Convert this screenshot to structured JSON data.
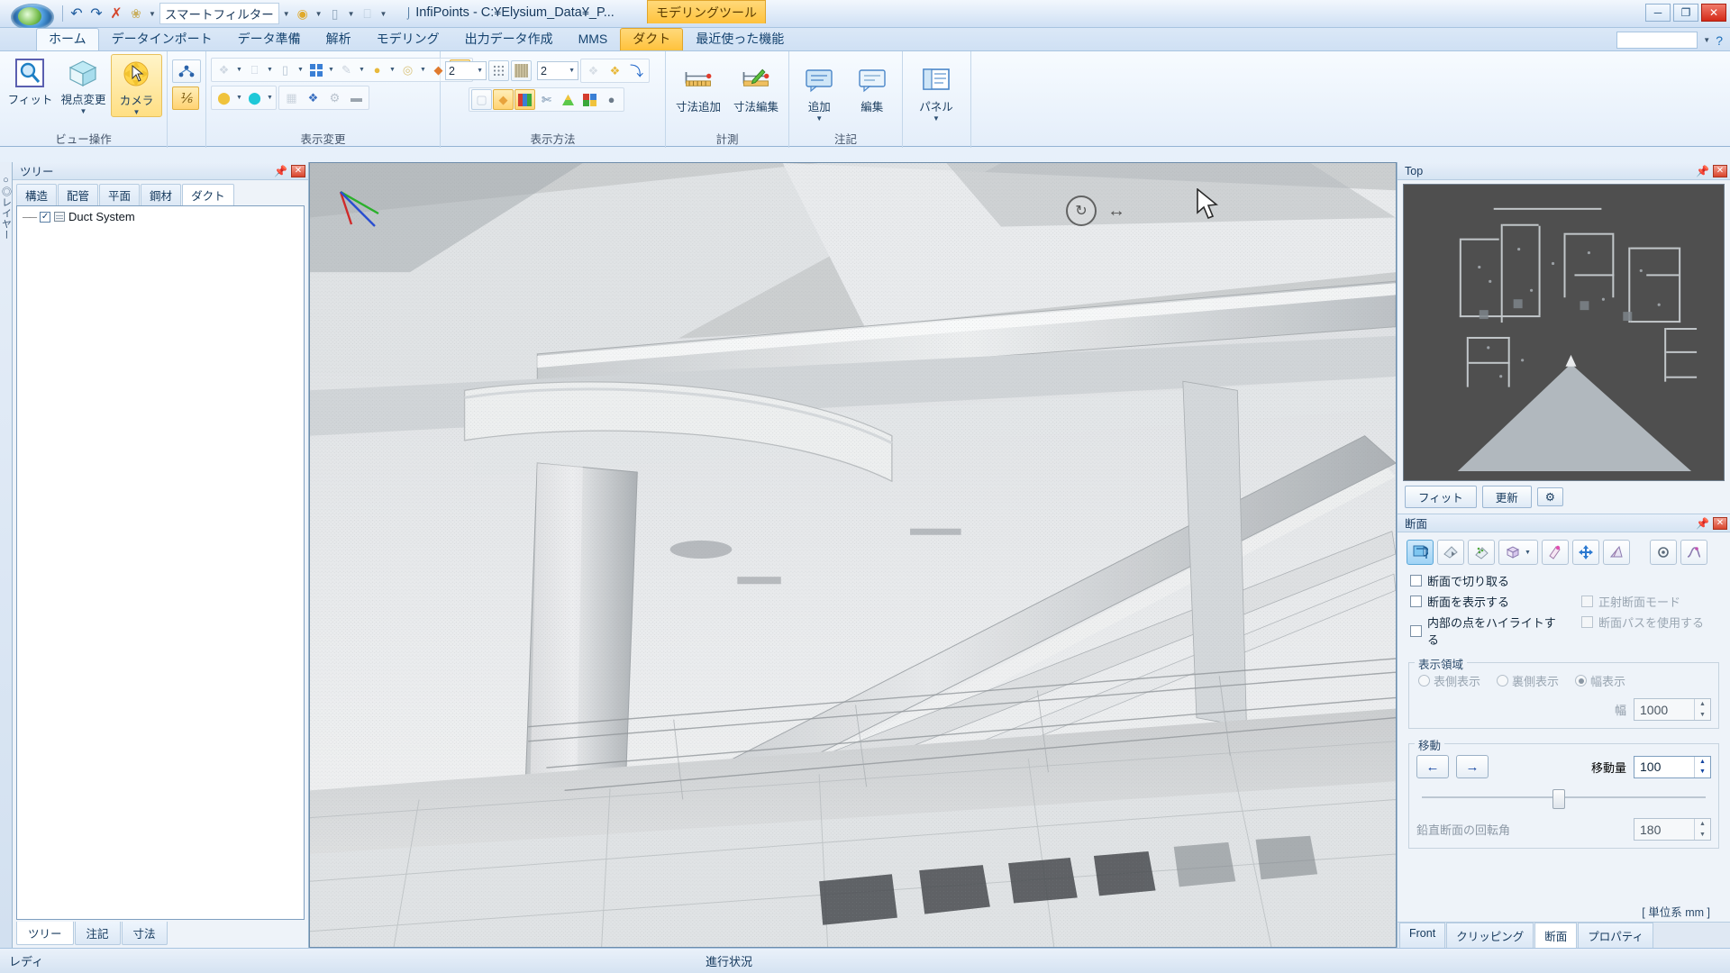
{
  "titlebar": {
    "app_title": "InfiPoints - C:¥Elysium_Data¥_P...",
    "context_tab": "モデリングツール",
    "quick_access": [
      {
        "name": "undo-icon",
        "glyph": "↩"
      },
      {
        "name": "redo-icon",
        "glyph": "↪"
      },
      {
        "name": "delete-icon",
        "glyph": "✕"
      },
      {
        "name": "filter-icon",
        "glyph": "⚘"
      }
    ],
    "smart_filter_label": "スマートフィルター",
    "window_controls": {
      "minimize": "─",
      "maximize": "❐",
      "close": "✕"
    }
  },
  "ribbon": {
    "tabs": [
      {
        "label": "ホーム",
        "state": "active"
      },
      {
        "label": "データインポート",
        "state": ""
      },
      {
        "label": "データ準備",
        "state": ""
      },
      {
        "label": "解析",
        "state": ""
      },
      {
        "label": "モデリング",
        "state": ""
      },
      {
        "label": "出力データ作成",
        "state": ""
      },
      {
        "label": "MMS",
        "state": ""
      },
      {
        "label": "ダクト",
        "state": "ctxactive"
      },
      {
        "label": "最近使った機能",
        "state": ""
      }
    ],
    "help_icon": "?",
    "groups": [
      {
        "name": "view-ops",
        "title": "ビュー操作",
        "big_buttons": [
          {
            "label": "フィット",
            "icon": "magnifier-icon",
            "dropdown": false,
            "selected": false
          },
          {
            "label": "視点変更",
            "icon": "cube-icon",
            "dropdown": true,
            "selected": false
          },
          {
            "label": "カメラ",
            "icon": "camera-orbit-icon",
            "dropdown": true,
            "selected": true
          }
        ]
      },
      {
        "name": "display-change",
        "title": "表示変更",
        "small_rows": [
          [
            {
              "icon": "point-cloud-icon",
              "dropdown": true,
              "framed": true
            },
            {
              "icon": "sparse-points-icon",
              "dropdown": true
            },
            {
              "icon": "mesh-outline-icon",
              "dropdown": true
            },
            {
              "icon": "cylinder-icon",
              "dropdown": true
            },
            {
              "icon": "grid-blue-icon",
              "dropdown": true,
              "on": false
            },
            {
              "icon": "pen-icon",
              "dropdown": true
            },
            {
              "icon": "sphere-yellow-icon",
              "dropdown": true
            },
            {
              "icon": "rings-icon",
              "dropdown": true
            },
            {
              "icon": "plane-orange-icon",
              "dropdown": false
            },
            {
              "icon": "cylinder-white-icon",
              "dropdown": false,
              "on": true
            }
          ],
          [
            {
              "icon": "yellow-chip-icon",
              "dropdown": true
            },
            {
              "icon": "cyan-sphere-icon",
              "dropdown": true
            },
            {
              "icon": "mesh-gray-icon",
              "dropdown": false
            },
            {
              "icon": "person-marker-icon",
              "dropdown": false
            },
            {
              "icon": "gear-icon",
              "dropdown": false
            },
            {
              "icon": "texture-icon",
              "dropdown": false
            }
          ]
        ]
      },
      {
        "name": "display-method",
        "title": "表示方法",
        "combo1": "2",
        "combo2": "2",
        "small_rows": [
          [
            {
              "icon": "dot-grid-icon"
            },
            {
              "icon": "stripe-icon"
            },
            {
              "icon": "points-faint-icon"
            },
            {
              "icon": "points-yellow-icon"
            },
            {
              "icon": "pick-point-icon"
            }
          ],
          [
            {
              "icon": "box-white-icon"
            },
            {
              "icon": "box-orange-icon",
              "on": true
            },
            {
              "icon": "color-bars-icon",
              "on": true
            },
            {
              "icon": "scissors-icon"
            },
            {
              "icon": "gradient-triangle-icon"
            },
            {
              "icon": "color-grid-icon"
            },
            {
              "icon": "shadow-ball-icon"
            }
          ]
        ]
      },
      {
        "name": "measurement",
        "title": "計測",
        "big_buttons": [
          {
            "label": "寸法追加",
            "icon": "dimension-add-icon",
            "dropdown": false,
            "selected": false
          },
          {
            "label": "寸法編集",
            "icon": "dimension-edit-icon",
            "dropdown": false,
            "selected": false
          }
        ]
      },
      {
        "name": "annotation",
        "title": "注記",
        "big_buttons": [
          {
            "label": "追加",
            "icon": "note-add-icon",
            "dropdown": true,
            "selected": false
          },
          {
            "label": "編集",
            "icon": "note-edit-icon",
            "dropdown": false,
            "selected": false
          }
        ]
      },
      {
        "name": "panel-group",
        "title": "",
        "big_buttons": [
          {
            "label": "パネル",
            "icon": "panel-icon",
            "dropdown": true,
            "selected": false
          }
        ]
      }
    ]
  },
  "left_panel": {
    "title": "ツリー",
    "tabs": [
      {
        "label": "構造",
        "active": false
      },
      {
        "label": "配管",
        "active": false
      },
      {
        "label": "平面",
        "active": false
      },
      {
        "label": "鋼材",
        "active": false
      },
      {
        "label": "ダクト",
        "active": true
      }
    ],
    "tree_items": [
      {
        "label": "Duct System",
        "checked": true
      }
    ],
    "bottom_tabs": [
      {
        "label": "ツリー",
        "active": true
      },
      {
        "label": "注記",
        "active": false
      },
      {
        "label": "寸法",
        "active": false
      }
    ]
  },
  "side_strip_label": "○◎レイヤー",
  "viewport": {
    "name": "point-cloud-3d-view",
    "nav_icons": [
      "orbit-icon",
      "pan-icon"
    ],
    "cursor": "mouse-pointer-icon"
  },
  "right_dock": {
    "top_panel": {
      "title": "Top",
      "buttons": [
        {
          "label": "フィット",
          "name": "minimap-fit-button"
        },
        {
          "label": "更新",
          "name": "minimap-refresh-button"
        },
        {
          "label": "⚙",
          "name": "minimap-settings-button"
        }
      ]
    },
    "section_panel": {
      "title": "断面",
      "toolbar": [
        {
          "name": "section-toggle-button",
          "glyph": "⬓",
          "active": true
        },
        {
          "name": "section-pick-button",
          "glyph": "◺"
        },
        {
          "name": "section-points-button",
          "glyph": "⁘"
        },
        {
          "name": "section-box-button",
          "glyph": "▭",
          "dropdown": true
        },
        {
          "name": "section-brush-button",
          "glyph": "✎"
        },
        {
          "name": "section-move-button",
          "glyph": "✥"
        },
        {
          "name": "section-plane-button",
          "glyph": "◢"
        },
        {
          "name": "section-settings-button",
          "glyph": "⚙"
        },
        {
          "name": "section-curve-button",
          "glyph": "∿"
        }
      ],
      "checkboxes": [
        {
          "label": "断面で切り取る",
          "checked": false,
          "disabled": false
        },
        {
          "label": "断面を表示する",
          "checked": false,
          "disabled": false
        },
        {
          "label": "正射断面モード",
          "checked": false,
          "disabled": true
        },
        {
          "label": "内部の点をハイライトする",
          "checked": false,
          "disabled": false
        },
        {
          "label": "断面パスを使用する",
          "checked": false,
          "disabled": true
        }
      ],
      "display_area": {
        "legend": "表示領域",
        "radios": [
          {
            "label": "表側表示",
            "selected": false
          },
          {
            "label": "裏側表示",
            "selected": false
          },
          {
            "label": "幅表示",
            "selected": true
          }
        ],
        "width_label": "幅",
        "width_value": "1000"
      },
      "move": {
        "legend": "移動",
        "left_arrow": "←",
        "right_arrow": "→",
        "amount_label": "移動量",
        "amount_value": "100",
        "rotation_label": "鉛直断面の回転角",
        "rotation_value": "180"
      },
      "unit_note": "[ 単位系 mm ]"
    },
    "bottom_tabs": [
      {
        "label": "Front",
        "active": false
      },
      {
        "label": "クリッピング",
        "active": false
      },
      {
        "label": "断面",
        "active": true
      },
      {
        "label": "プロパティ",
        "active": false
      }
    ]
  },
  "statusbar": {
    "ready": "レディ",
    "progress_label": "進行状況"
  },
  "colors": {
    "accent_orange": "#ffc23c",
    "accent_blue": "#1d6fb8",
    "panel_bg": "#eef3f9",
    "titlebar_text": "#16385c"
  }
}
